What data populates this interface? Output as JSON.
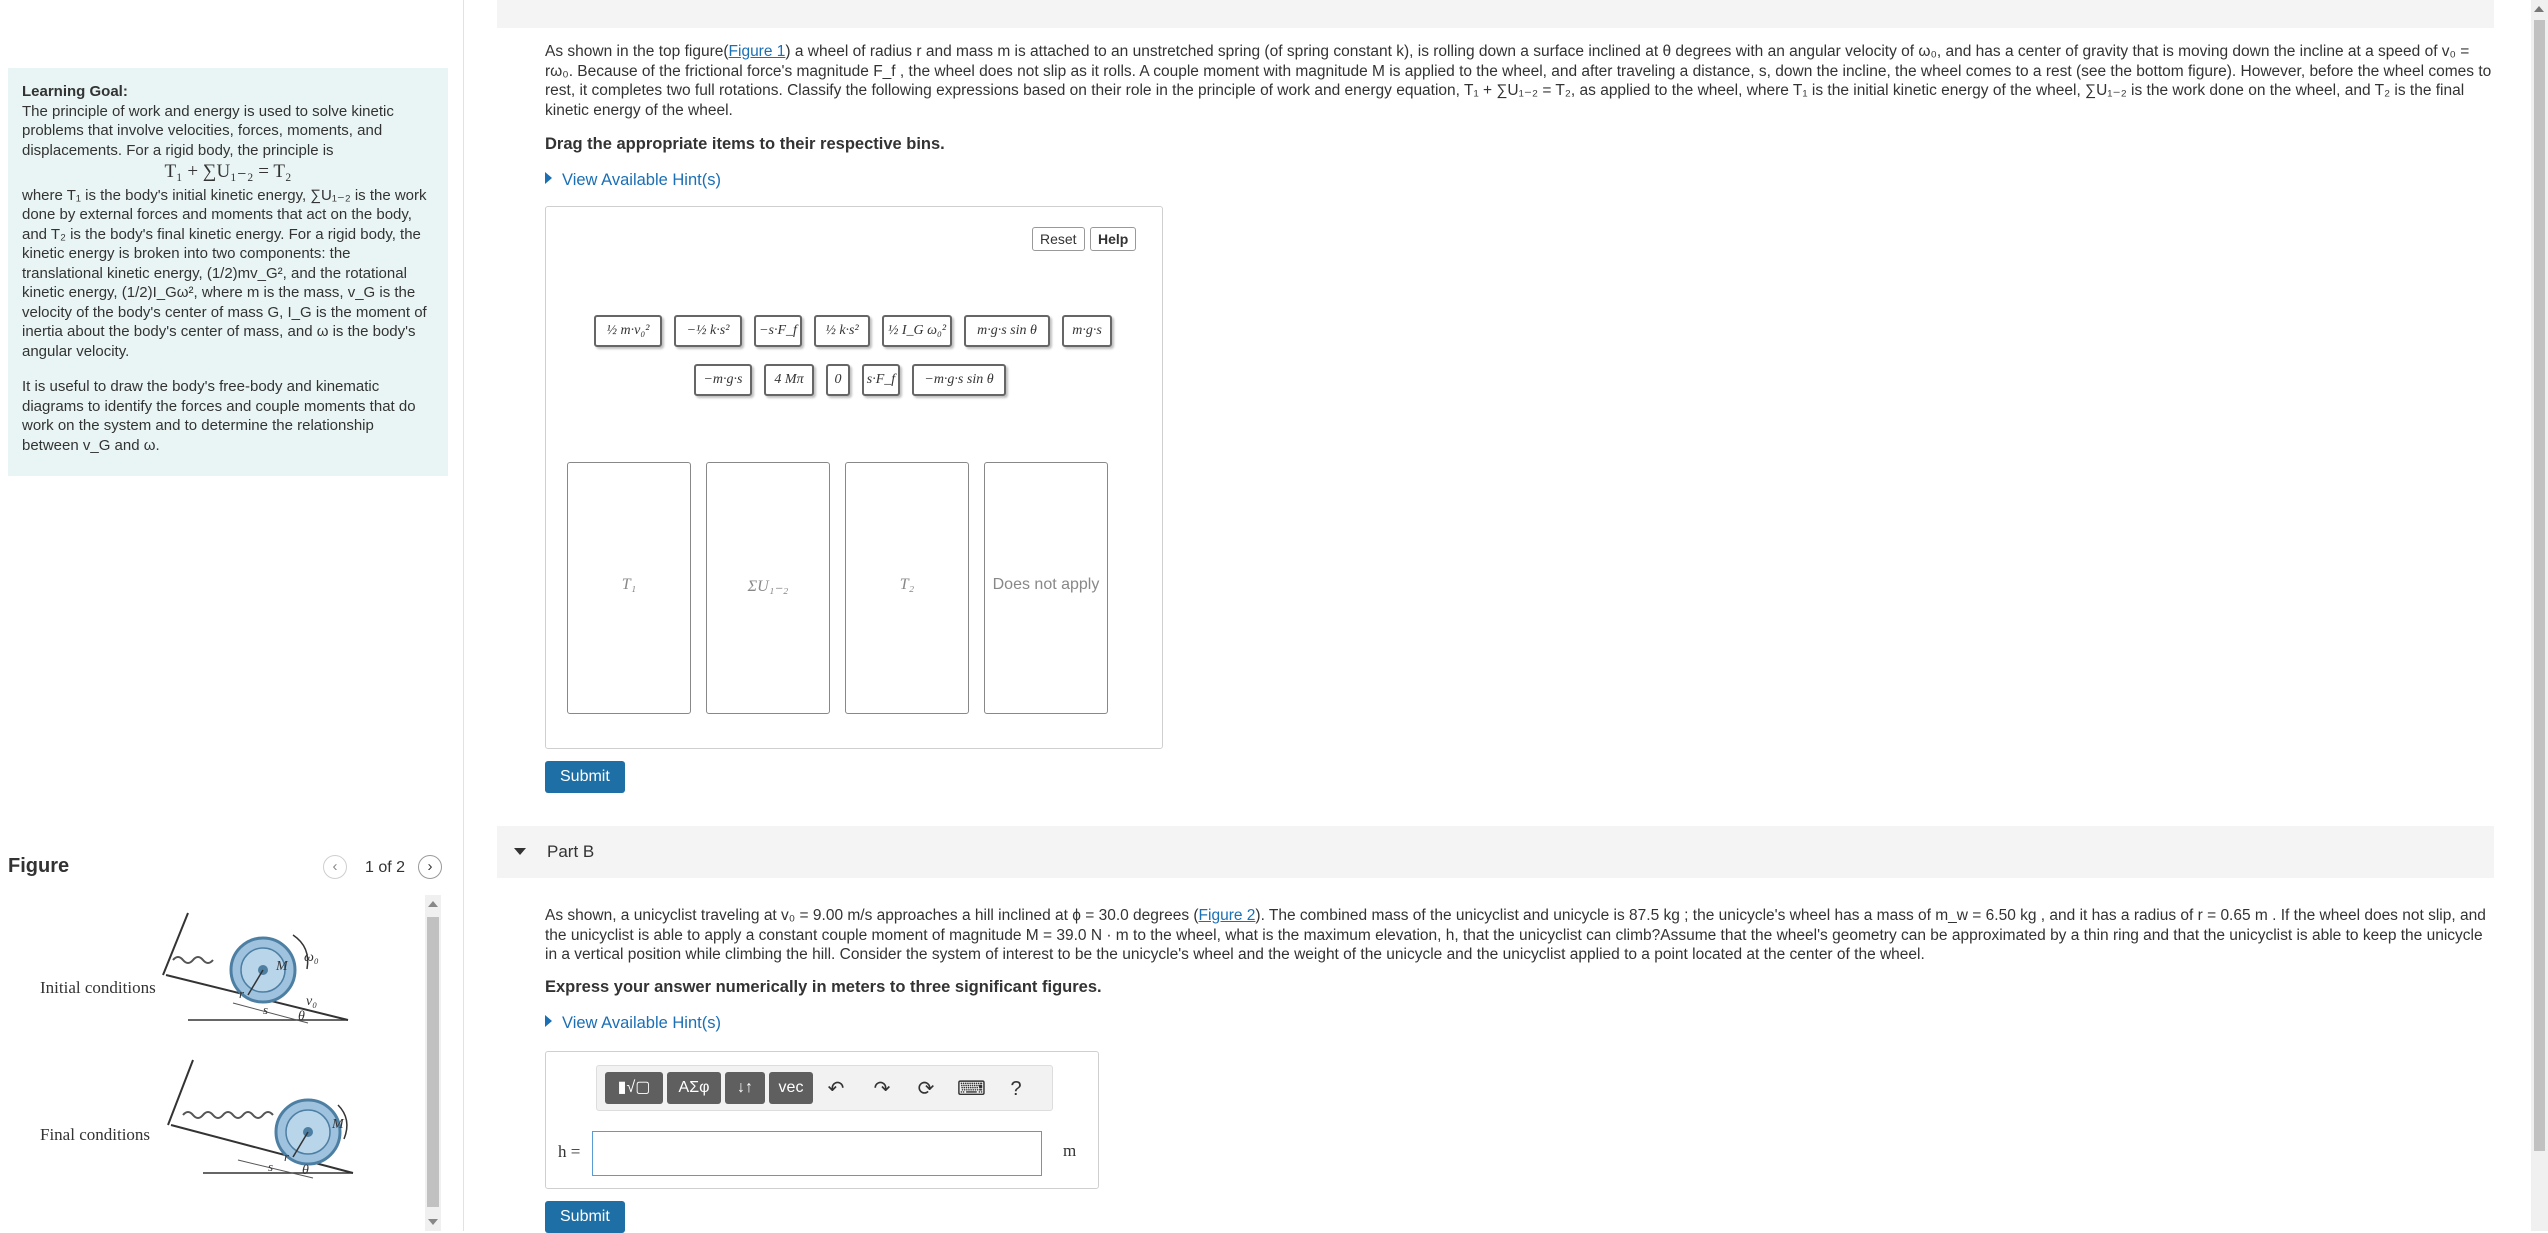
{
  "learning_goal": {
    "title": "Learning Goal:",
    "intro": "The principle of work and energy is used to solve kinetic problems that involve velocities, forces, moments, and displacements. For a rigid body, the principle is",
    "equation": "T₁ + ∑U₁₋₂ = T₂",
    "body": "where T₁ is the body's initial kinetic energy, ∑U₁₋₂ is the work done by external forces and moments that act on the body, and T₂ is the body's final kinetic energy. For a rigid body, the kinetic energy is broken into two components: the translational kinetic energy, (1/2)mv_G², and the rotational kinetic energy, (1/2)I_Gω², where m is the mass, v_G is the velocity of the body's center of mass G, I_G is the moment of inertia about the body's center of mass, and ω is the body's angular velocity.",
    "tip": "It is useful to draw the body's free-body and kinematic diagrams to identify the forces and couple moments that do work on the system and to determine the relationship between v_G and ω."
  },
  "figure": {
    "title": "Figure",
    "counter": "1 of 2",
    "initial_label": "Initial conditions",
    "final_label": "Final conditions",
    "omega_label": "ω₀",
    "v_label": "v₀",
    "M_label": "M",
    "r_label": "r",
    "s_label": "s",
    "theta_label": "θ"
  },
  "partA": {
    "problem_pre": "As shown in the top figure(",
    "figure_link": "Figure 1",
    "problem_post": ") a wheel of radius r and mass m is attached to an unstretched spring (of spring constant k), is rolling down a surface inclined at θ degrees with an angular velocity of ω₀, and has a center of gravity that is moving down the incline at a speed of v₀ = rω₀. Because of the frictional force's magnitude F_f , the wheel does not slip as it rolls. A couple moment with magnitude M is applied to the wheel, and after traveling a distance, s, down the incline, the wheel comes to a rest (see the bottom figure). However, before the wheel comes to rest, it completes two full rotations. Classify the following expressions based on their role in the principle of work and energy equation, T₁ + ∑U₁₋₂ = T₂, as applied to the wheel, where T₁ is the initial kinetic energy of the wheel, ∑U₁₋₂ is the work done on the wheel, and T₂ is the final kinetic energy of the wheel.",
    "instruction": "Drag the appropriate items to their respective bins.",
    "hint": "View Available Hint(s)",
    "reset": "Reset",
    "help": "Help",
    "tiles_row1": [
      "½ m·v₀²",
      "−½ k·s²",
      "−s·F_f",
      "½ k·s²",
      "½ I_G ω₀²",
      "m·g·s sin θ",
      "m·g·s"
    ],
    "tiles_row2": [
      "−m·g·s",
      "4 Mπ",
      "0",
      "s·F_f",
      "−m·g·s sin θ"
    ],
    "bins": [
      "T₁",
      "ΣU₁₋₂",
      "T₂",
      "Does not apply"
    ],
    "submit": "Submit"
  },
  "partB": {
    "title": "Part B",
    "problem_pre": "As shown, a unicyclist traveling at v₀ = 9.00 m/s approaches a hill inclined at ϕ = 30.0 degrees (",
    "figure_link": "Figure 2",
    "problem_post": "). The combined mass of the unicyclist and unicycle is 87.5 kg ; the unicycle's wheel has a mass of m_w = 6.50 kg , and it has a radius of r = 0.65 m . If the wheel does not slip, and the unicyclist is able to apply a constant couple moment of magnitude M = 39.0 N · m to the wheel, what is the maximum elevation, h, that the unicyclist can climb?Assume that the wheel's geometry can be approximated by a thin ring and that the unicyclist is able to keep the unicycle in a vertical position while climbing the hill. Consider the system of interest to be the unicycle's wheel and the weight of the unicycle and the unicyclist applied to a point located at the center of the wheel.",
    "instruction": "Express your answer numerically in meters to three significant figures.",
    "hint": "View Available Hint(s)",
    "toolbar": {
      "templates": "▮√▢",
      "symbols": "ΑΣφ",
      "arrows": "↓↑",
      "vec": "vec",
      "undo": "↶",
      "redo": "↷",
      "reset": "⟳",
      "keyboard": "⌨",
      "help": "?"
    },
    "answer_label": "h =",
    "answer_value": "",
    "unit": "m",
    "submit": "Submit"
  }
}
